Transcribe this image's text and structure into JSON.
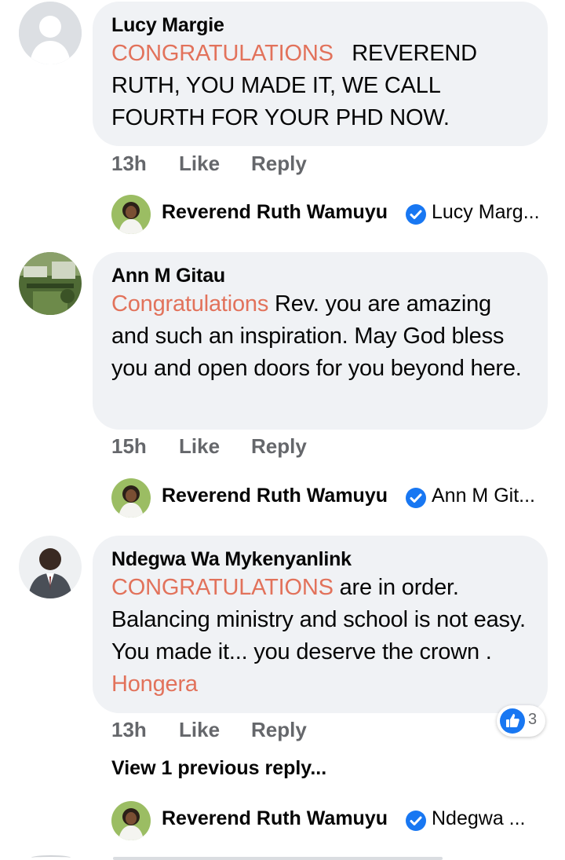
{
  "comments": [
    {
      "author": "Lucy Margie",
      "body": [
        {
          "text": "CONGRATULATIONS",
          "highlight": true
        },
        {
          "text": "   REVEREND RUTH, YOU MADE IT, WE CALL FOURTH FOR YOUR PHD NOW.",
          "highlight": false
        }
      ],
      "time": "13h",
      "like_label": "Like",
      "reply_label": "Reply",
      "reply": {
        "name": "Reverend Ruth Wamuyu",
        "preview": "Lucy Marg..."
      }
    },
    {
      "author": "Ann M Gitau",
      "body": [
        {
          "text": "Congratulations",
          "highlight": true
        },
        {
          "text": " Rev. you are amazing and such an inspiration. May God bless you and open doors for you beyond here.",
          "highlight": false
        }
      ],
      "time": "15h",
      "like_label": "Like",
      "reply_label": "Reply",
      "reply": {
        "name": "Reverend Ruth Wamuyu",
        "preview": "Ann M Git..."
      }
    },
    {
      "author": "Ndegwa Wa Mykenyanlink",
      "body": [
        {
          "text": "CONGRATULATIONS",
          "highlight": true
        },
        {
          "text": " are in order. Balancing ministry and school is not easy. You made it... you deserve the crown .  ",
          "highlight": false
        },
        {
          "text": "Hongera",
          "highlight": true
        }
      ],
      "time": "13h",
      "like_label": "Like",
      "reply_label": "Reply",
      "reaction_count": "3",
      "view_previous": "View 1 previous reply...",
      "reply": {
        "name": "Reverend Ruth Wamuyu",
        "preview": "Ndegwa ..."
      }
    }
  ],
  "icons": {
    "reaction": "like-thumb-icon",
    "verified": "verified-check-icon"
  },
  "colors": {
    "bubble": "#f0f2f5",
    "highlight": "#e2725b",
    "meta": "#65676b",
    "accent": "#1877f2"
  }
}
